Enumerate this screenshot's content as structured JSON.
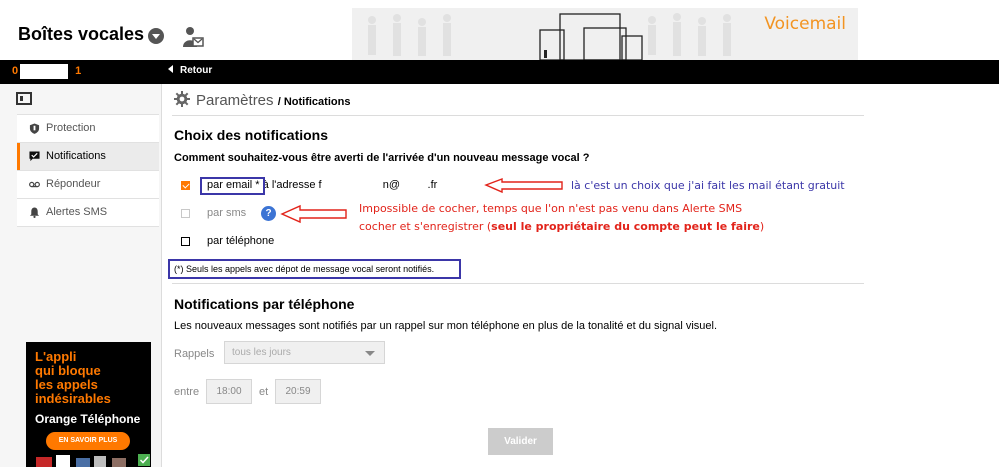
{
  "header": {
    "title": "Boîtes vocales",
    "banner_text": "Voicemail"
  },
  "topbar": {
    "account_prefix": "0",
    "account_suffix": "1",
    "back_label": "Retour"
  },
  "sidebar": {
    "items": [
      {
        "label": "Protection",
        "icon": "shield-icon",
        "active": false
      },
      {
        "label": "Notifications",
        "icon": "chat-icon",
        "active": true
      },
      {
        "label": "Répondeur",
        "icon": "voicemail-icon",
        "active": false
      },
      {
        "label": "Alertes SMS",
        "icon": "bell-icon",
        "active": false
      }
    ],
    "promo": {
      "lines": [
        "L'appli",
        "qui bloque",
        "les appels",
        "indésirables"
      ],
      "brand": "Orange Téléphone",
      "button": "EN SAVOIR PLUS"
    }
  },
  "main": {
    "crumb_root": "Paramètres",
    "crumb_sep": "/",
    "crumb_current": "Notifications",
    "choice": {
      "title": "Choix des notifications",
      "question": "Comment souhaitez-vous être averti de l'arrivée d'un nouveau message vocal ?",
      "options": [
        {
          "label": "par email *",
          "detail": "à l'adresse f                    n@         .fr",
          "checked": true,
          "disabled": false
        },
        {
          "label": "par sms",
          "detail": "",
          "checked": false,
          "disabled": true
        },
        {
          "label": "par téléphone",
          "detail": "",
          "checked": false,
          "disabled": false
        }
      ],
      "note": "(*) Seuls les appels avec dépot de message vocal seront notifiés."
    },
    "phone": {
      "title": "Notifications par téléphone",
      "description": "Les nouveaux messages sont notifiés par un rappel sur mon téléphone en plus de la tonalité et du signal visuel.",
      "rappels_label": "Rappels",
      "rappels_value": "tous les jours",
      "entre_label": "entre",
      "start": "18:00",
      "et_label": "et",
      "end": "20:59"
    },
    "submit_label": "Valider"
  },
  "annotations": {
    "email_note": "là c'est un choix que j'ai fait les mail étant gratuit",
    "sms_note_1": "Impossible de cocher, temps que l'on n'est pas venu dans Alerte SMS",
    "sms_note_2a": "cocher et s'enregistrer (",
    "sms_note_2b": "seul le propriétaire du compte peut le faire",
    "sms_note_2c": ")"
  },
  "colors": {
    "accent": "#ff7900",
    "annotation_blue": "#3b36a8",
    "annotation_red": "#e2231a"
  }
}
